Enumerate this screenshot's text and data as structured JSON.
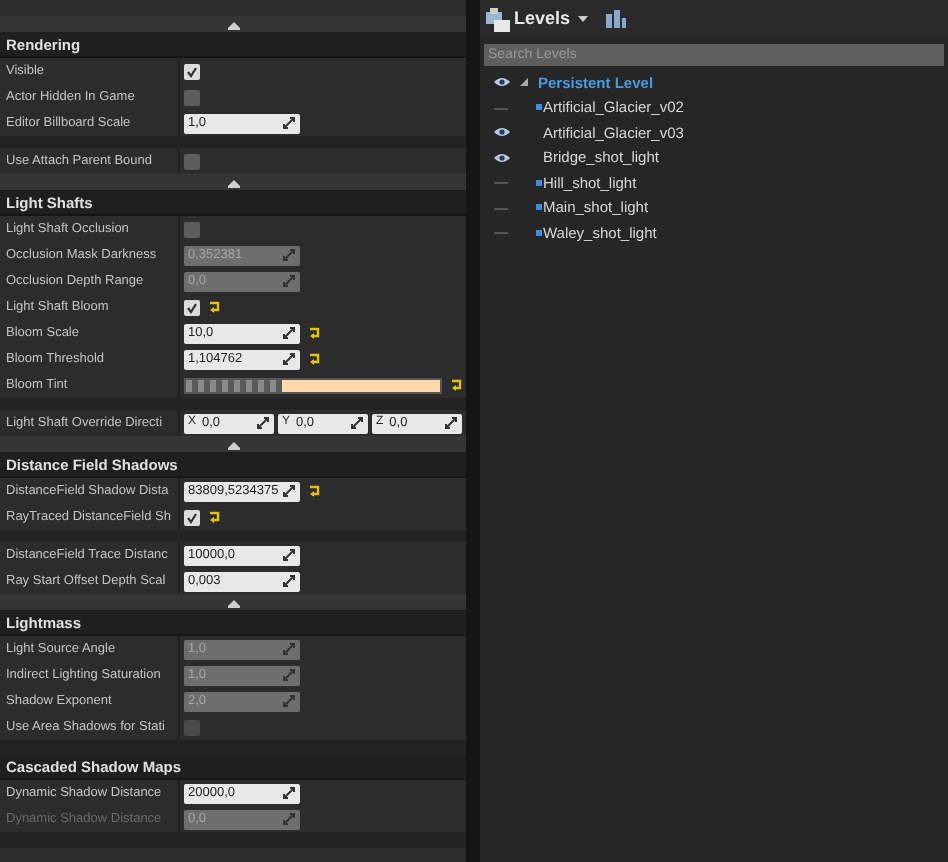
{
  "details": {
    "sections": [
      {
        "title": "Rendering",
        "advanced_toggle": true,
        "groups": [
          [
            {
              "kind": "checkbox",
              "label": "Visible",
              "checked": true
            },
            {
              "kind": "checkbox",
              "label": "Actor Hidden In Game",
              "checked": false
            },
            {
              "kind": "number",
              "label": "Editor Billboard Scale",
              "value": "1,0",
              "disabled": false
            }
          ],
          [
            {
              "kind": "checkbox",
              "label": "Use Attach Parent Bound",
              "checked": false
            }
          ]
        ]
      },
      {
        "title": "Light Shafts",
        "advanced_toggle": true,
        "groups": [
          [
            {
              "kind": "checkbox",
              "label": "Light Shaft Occlusion",
              "checked": false
            },
            {
              "kind": "number",
              "label": "Occlusion Mask Darkness",
              "value": "0,352381",
              "disabled": true
            },
            {
              "kind": "number",
              "label": "Occlusion Depth Range",
              "value": "0,0",
              "disabled": true
            },
            {
              "kind": "checkbox",
              "label": "Light Shaft Bloom",
              "checked": true,
              "reset": true
            },
            {
              "kind": "number",
              "label": "Bloom Scale",
              "value": "10,0",
              "disabled": false,
              "reset": true
            },
            {
              "kind": "number",
              "label": "Bloom Threshold",
              "value": "1,104762",
              "disabled": false,
              "reset": true
            },
            {
              "kind": "color",
              "label": "Bloom Tint",
              "color": "#ffd9a8",
              "reset": true
            }
          ],
          [
            {
              "kind": "vector",
              "label": "Light Shaft Override Directi",
              "components": [
                {
                  "axis": "X",
                  "value": "0,0"
                },
                {
                  "axis": "Y",
                  "value": "0,0"
                },
                {
                  "axis": "Z",
                  "value": "0,0"
                }
              ]
            }
          ]
        ]
      },
      {
        "title": "Distance Field Shadows",
        "advanced_toggle": true,
        "groups": [
          [
            {
              "kind": "number",
              "label": "DistanceField Shadow Dista",
              "value": "83809,5234375",
              "disabled": false,
              "reset": true
            },
            {
              "kind": "checkbox",
              "label": "RayTraced DistanceField Sh",
              "checked": true,
              "reset": true
            }
          ],
          [
            {
              "kind": "number",
              "label": "DistanceField Trace Distanc",
              "value": "10000,0",
              "disabled": false
            },
            {
              "kind": "number",
              "label": "Ray Start Offset Depth Scal",
              "value": "0,003",
              "disabled": false
            }
          ]
        ]
      },
      {
        "title": "Lightmass",
        "advanced_toggle": false,
        "groups": [
          [
            {
              "kind": "number",
              "label": "Light Source Angle",
              "value": "1,0",
              "disabled": true
            },
            {
              "kind": "number",
              "label": "Indirect Lighting Saturation",
              "value": "1,0",
              "disabled": true
            },
            {
              "kind": "number",
              "label": "Shadow Exponent",
              "value": "2,0",
              "disabled": true
            },
            {
              "kind": "checkbox",
              "label": "Use Area Shadows for Stati",
              "checked": false,
              "disabled": true
            }
          ]
        ]
      },
      {
        "title": "Cascaded Shadow Maps",
        "advanced_toggle": false,
        "groups": [
          [
            {
              "kind": "number",
              "label": "Dynamic Shadow Distance",
              "value": "20000,0",
              "disabled": false
            },
            {
              "kind": "number",
              "label": "Dynamic Shadow Distance",
              "value": "0,0",
              "disabled": true,
              "label_disabled": true
            }
          ]
        ]
      }
    ]
  },
  "levels": {
    "title": "Levels",
    "search": {
      "placeholder": "Search Levels"
    },
    "tree": [
      {
        "name": "Persistent Level",
        "visible": true,
        "expanded": true,
        "children": [
          {
            "name": "Artificial_Glacier_v02",
            "visible": false,
            "marker": true
          },
          {
            "name": "Artificial_Glacier_v03",
            "visible": true,
            "marker": false
          },
          {
            "name": "Bridge_shot_light",
            "visible": true,
            "marker": false
          },
          {
            "name": "Hill_shot_light",
            "visible": false,
            "marker": true
          },
          {
            "name": "Main_shot_light",
            "visible": false,
            "marker": true
          },
          {
            "name": "Waley_shot_light",
            "visible": false,
            "marker": true
          }
        ]
      }
    ]
  }
}
